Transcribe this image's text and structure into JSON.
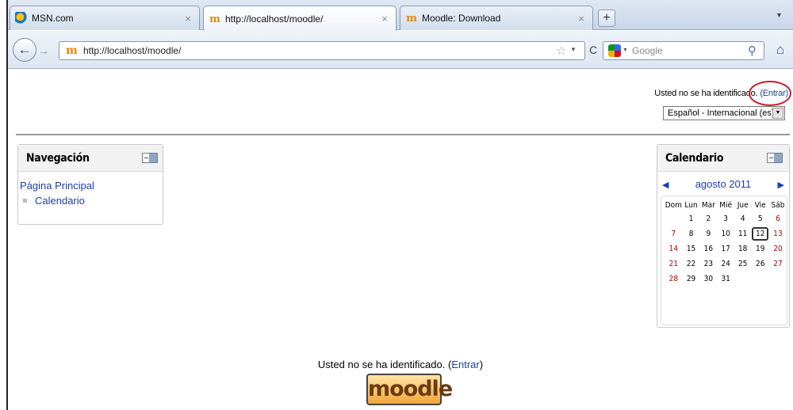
{
  "browser": {
    "tabs": [
      {
        "title": "MSN.com",
        "active": false
      },
      {
        "title": "http://localhost/moodle/",
        "active": true
      },
      {
        "title": "Moodle: Download",
        "active": false
      }
    ],
    "new_tab": "+",
    "tab_list_icon": "▼",
    "url": "http://localhost/moodle/",
    "search_placeholder": "Google",
    "back_glyph": "←",
    "forward_glyph": "→",
    "reload_glyph": "C",
    "home_glyph": "⌂"
  },
  "header": {
    "login_text": "Usted no se ha identificado.",
    "login_link": "(Entrar)",
    "language": "Español - Internacional (es)"
  },
  "navigation": {
    "title": "Navegación",
    "home_link": "Página Principal",
    "items": [
      {
        "label": "Calendario"
      }
    ]
  },
  "calendar": {
    "title": "Calendario",
    "month": "agosto 2011",
    "weekdays": [
      "Dom",
      "Lun",
      "Mar",
      "Mié",
      "Jue",
      "Vie",
      "Sáb"
    ],
    "weeks": [
      [
        "",
        "1",
        "2",
        "3",
        "4",
        "5",
        "6"
      ],
      [
        "7",
        "8",
        "9",
        "10",
        "11",
        "12",
        "13"
      ],
      [
        "14",
        "15",
        "16",
        "17",
        "18",
        "19",
        "20"
      ],
      [
        "21",
        "22",
        "23",
        "24",
        "25",
        "26",
        "27"
      ],
      [
        "28",
        "29",
        "30",
        "31",
        "",
        "",
        ""
      ]
    ],
    "today": "12"
  },
  "footer": {
    "login_text": "Usted no se ha identificado.",
    "login_link": "Entrar",
    "logo": "moodle"
  }
}
